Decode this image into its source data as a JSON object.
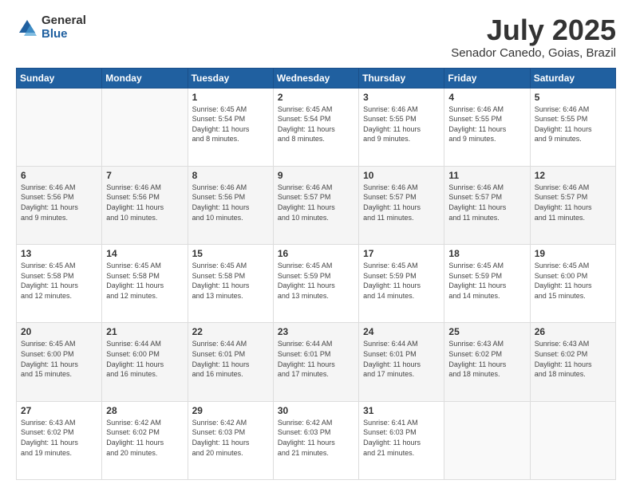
{
  "logo": {
    "general": "General",
    "blue": "Blue"
  },
  "header": {
    "title": "July 2025",
    "subtitle": "Senador Canedo, Goias, Brazil"
  },
  "weekdays": [
    "Sunday",
    "Monday",
    "Tuesday",
    "Wednesday",
    "Thursday",
    "Friday",
    "Saturday"
  ],
  "weeks": [
    [
      {
        "day": "",
        "info": ""
      },
      {
        "day": "",
        "info": ""
      },
      {
        "day": "1",
        "info": "Sunrise: 6:45 AM\nSunset: 5:54 PM\nDaylight: 11 hours\nand 8 minutes."
      },
      {
        "day": "2",
        "info": "Sunrise: 6:45 AM\nSunset: 5:54 PM\nDaylight: 11 hours\nand 8 minutes."
      },
      {
        "day": "3",
        "info": "Sunrise: 6:46 AM\nSunset: 5:55 PM\nDaylight: 11 hours\nand 9 minutes."
      },
      {
        "day": "4",
        "info": "Sunrise: 6:46 AM\nSunset: 5:55 PM\nDaylight: 11 hours\nand 9 minutes."
      },
      {
        "day": "5",
        "info": "Sunrise: 6:46 AM\nSunset: 5:55 PM\nDaylight: 11 hours\nand 9 minutes."
      }
    ],
    [
      {
        "day": "6",
        "info": "Sunrise: 6:46 AM\nSunset: 5:56 PM\nDaylight: 11 hours\nand 9 minutes."
      },
      {
        "day": "7",
        "info": "Sunrise: 6:46 AM\nSunset: 5:56 PM\nDaylight: 11 hours\nand 10 minutes."
      },
      {
        "day": "8",
        "info": "Sunrise: 6:46 AM\nSunset: 5:56 PM\nDaylight: 11 hours\nand 10 minutes."
      },
      {
        "day": "9",
        "info": "Sunrise: 6:46 AM\nSunset: 5:57 PM\nDaylight: 11 hours\nand 10 minutes."
      },
      {
        "day": "10",
        "info": "Sunrise: 6:46 AM\nSunset: 5:57 PM\nDaylight: 11 hours\nand 11 minutes."
      },
      {
        "day": "11",
        "info": "Sunrise: 6:46 AM\nSunset: 5:57 PM\nDaylight: 11 hours\nand 11 minutes."
      },
      {
        "day": "12",
        "info": "Sunrise: 6:46 AM\nSunset: 5:57 PM\nDaylight: 11 hours\nand 11 minutes."
      }
    ],
    [
      {
        "day": "13",
        "info": "Sunrise: 6:45 AM\nSunset: 5:58 PM\nDaylight: 11 hours\nand 12 minutes."
      },
      {
        "day": "14",
        "info": "Sunrise: 6:45 AM\nSunset: 5:58 PM\nDaylight: 11 hours\nand 12 minutes."
      },
      {
        "day": "15",
        "info": "Sunrise: 6:45 AM\nSunset: 5:58 PM\nDaylight: 11 hours\nand 13 minutes."
      },
      {
        "day": "16",
        "info": "Sunrise: 6:45 AM\nSunset: 5:59 PM\nDaylight: 11 hours\nand 13 minutes."
      },
      {
        "day": "17",
        "info": "Sunrise: 6:45 AM\nSunset: 5:59 PM\nDaylight: 11 hours\nand 14 minutes."
      },
      {
        "day": "18",
        "info": "Sunrise: 6:45 AM\nSunset: 5:59 PM\nDaylight: 11 hours\nand 14 minutes."
      },
      {
        "day": "19",
        "info": "Sunrise: 6:45 AM\nSunset: 6:00 PM\nDaylight: 11 hours\nand 15 minutes."
      }
    ],
    [
      {
        "day": "20",
        "info": "Sunrise: 6:45 AM\nSunset: 6:00 PM\nDaylight: 11 hours\nand 15 minutes."
      },
      {
        "day": "21",
        "info": "Sunrise: 6:44 AM\nSunset: 6:00 PM\nDaylight: 11 hours\nand 16 minutes."
      },
      {
        "day": "22",
        "info": "Sunrise: 6:44 AM\nSunset: 6:01 PM\nDaylight: 11 hours\nand 16 minutes."
      },
      {
        "day": "23",
        "info": "Sunrise: 6:44 AM\nSunset: 6:01 PM\nDaylight: 11 hours\nand 17 minutes."
      },
      {
        "day": "24",
        "info": "Sunrise: 6:44 AM\nSunset: 6:01 PM\nDaylight: 11 hours\nand 17 minutes."
      },
      {
        "day": "25",
        "info": "Sunrise: 6:43 AM\nSunset: 6:02 PM\nDaylight: 11 hours\nand 18 minutes."
      },
      {
        "day": "26",
        "info": "Sunrise: 6:43 AM\nSunset: 6:02 PM\nDaylight: 11 hours\nand 18 minutes."
      }
    ],
    [
      {
        "day": "27",
        "info": "Sunrise: 6:43 AM\nSunset: 6:02 PM\nDaylight: 11 hours\nand 19 minutes."
      },
      {
        "day": "28",
        "info": "Sunrise: 6:42 AM\nSunset: 6:02 PM\nDaylight: 11 hours\nand 20 minutes."
      },
      {
        "day": "29",
        "info": "Sunrise: 6:42 AM\nSunset: 6:03 PM\nDaylight: 11 hours\nand 20 minutes."
      },
      {
        "day": "30",
        "info": "Sunrise: 6:42 AM\nSunset: 6:03 PM\nDaylight: 11 hours\nand 21 minutes."
      },
      {
        "day": "31",
        "info": "Sunrise: 6:41 AM\nSunset: 6:03 PM\nDaylight: 11 hours\nand 21 minutes."
      },
      {
        "day": "",
        "info": ""
      },
      {
        "day": "",
        "info": ""
      }
    ]
  ]
}
